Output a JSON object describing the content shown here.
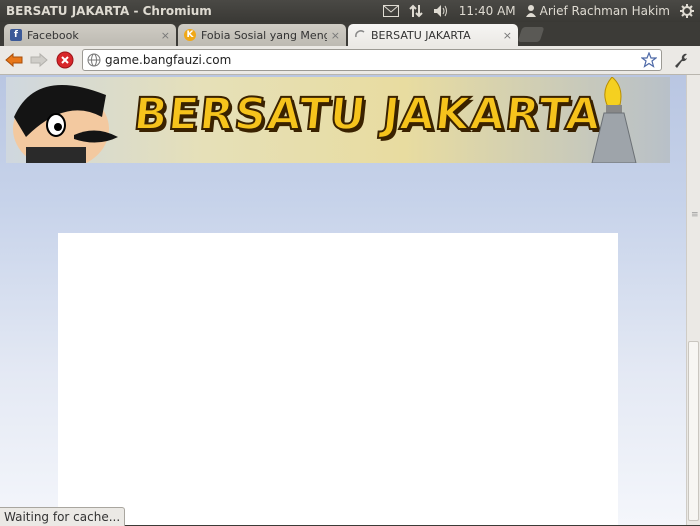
{
  "window": {
    "title": "BERSATU JAKARTA - Chromium"
  },
  "tray": {
    "mail_icon": "mail-icon",
    "network_icon": "network-updown-icon",
    "volume_icon": "volume-icon",
    "time": "11:40 AM",
    "user_name": "Arief Rachman Hakim",
    "session_icon": "gear-power-icon"
  },
  "tabs": [
    {
      "label": "Facebook",
      "favicon": "facebook-icon",
      "active": false
    },
    {
      "label": "Fobia Sosial yang Menghar",
      "favicon": "kaskus-icon",
      "active": false
    },
    {
      "label": "BERSATU JAKARTA",
      "favicon": "loading-spinner-icon",
      "active": true
    }
  ],
  "tab_close_glyph": "×",
  "toolbar": {
    "url": "game.bangfauzi.com",
    "back_icon": "back-arrow-icon",
    "forward_icon": "forward-arrow-icon",
    "stop_icon": "stop-icon",
    "star_icon": "bookmark-star-icon",
    "wrench_icon": "wrench-icon"
  },
  "page": {
    "banner_title": "BERSATU JAKARTA"
  },
  "status": {
    "text": "Waiting for cache..."
  }
}
